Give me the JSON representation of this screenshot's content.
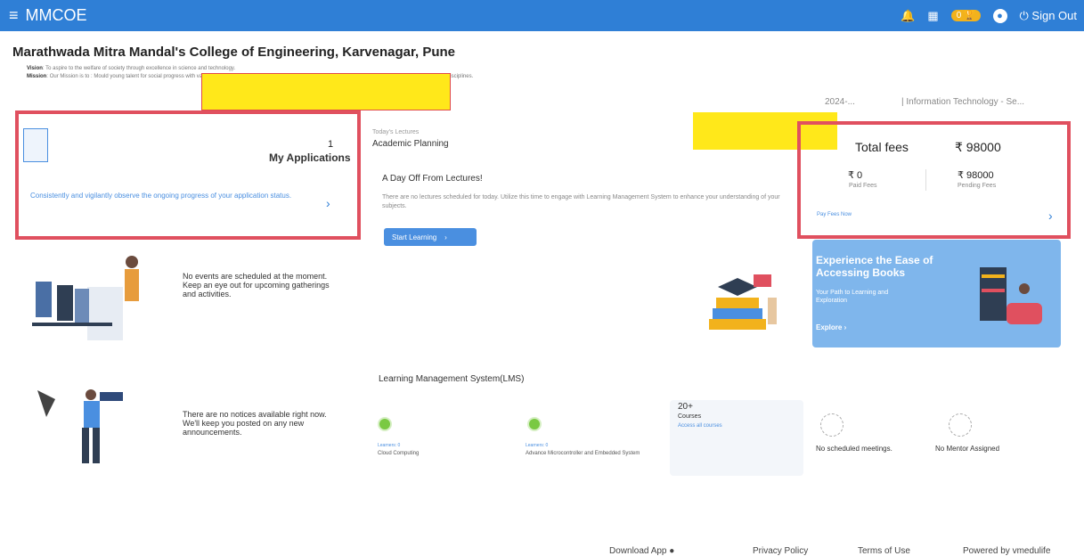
{
  "topbar": {
    "brand": "MMCOE",
    "menu_icon": "menu-icon",
    "coin_badge": "0",
    "sign_out": "Sign Out"
  },
  "college": {
    "name": "Marathwada Mitra Mandal's College of Engineering, Karvenagar, Pune",
    "vision_label": "Vision",
    "vision_text": "To aspire to the welfare of society through excellence in science and technology.",
    "mission_label": "Mission",
    "mission_text": "Our Mission is to : Mould young talent for social progress with values and ethics. Orient faculty and students for research and development. Emphasize excellence in all disciplines.",
    "year": "2024-...",
    "department": "| Information Technology - Se..."
  },
  "applications": {
    "count": "1",
    "label": "My Applications",
    "description": "Consistently and vigilantly observe the ongoing progress of your application status."
  },
  "lectures": {
    "small_label": "Today's Lectures",
    "title": "Academic Planning",
    "dayoff_heading": "A Day Off From Lectures!",
    "dayoff_desc": "There are no lectures scheduled for today. Utilize this time to engage with Learning Management System to enhance your understanding of your subjects.",
    "start_button": "Start Learning"
  },
  "fees": {
    "title": "Total fees",
    "total": "₹ 98000",
    "paid_value": "₹ 0",
    "paid_label": "Paid Fees",
    "pending_value": "₹ 98000",
    "pending_label": "Pending Fees",
    "pay_link": "Pay Fees Now"
  },
  "events": {
    "text": "No events are scheduled at the moment. Keep an eye out for upcoming gatherings and activities."
  },
  "notices": {
    "text": "There are no notices available right now. We'll keep you posted on any new announcements."
  },
  "books": {
    "heading": "Experience the Ease of Accessing Books",
    "subtext": "Your Path to Learning and Exploration",
    "explore": "Explore"
  },
  "lms": {
    "title": "Learning Management System(LMS)",
    "courses": [
      {
        "label": "Learners: 0",
        "name": "Cloud Computing"
      },
      {
        "label": "Learners: 0",
        "name": "Advance Microcontroller and Embedded System"
      }
    ],
    "count": "20+",
    "count_label": "Courses",
    "count_link": "Access all courses"
  },
  "meetings": {
    "text": "No scheduled meetings."
  },
  "mentor": {
    "text": "No Mentor Assigned"
  },
  "footer": {
    "download": "Download App",
    "privacy": "Privacy Policy",
    "terms": "Terms of Use",
    "powered": "Powered by vmedulife"
  },
  "colors": {
    "primary": "#2f7fd6",
    "highlight": "#ffe81a",
    "frame": "#e0505f",
    "books_bg": "#7fb6ec"
  }
}
